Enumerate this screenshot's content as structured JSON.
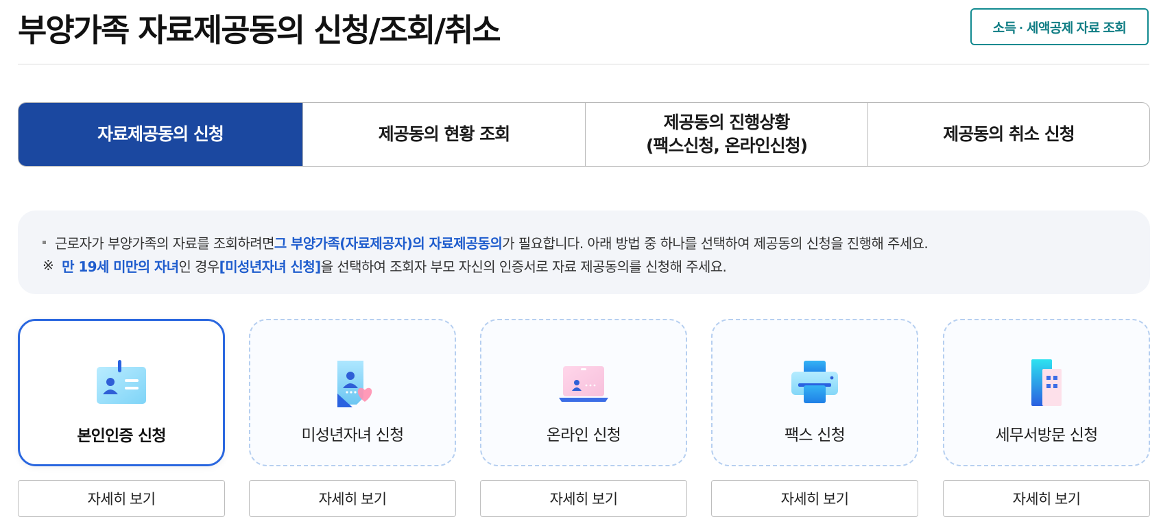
{
  "header": {
    "title": "부양가족 자료제공동의 신청/조회/취소",
    "top_button": "소득 · 세액공제 자료 조회"
  },
  "tabs": [
    {
      "lines": [
        "자료제공동의 신청"
      ],
      "active": true
    },
    {
      "lines": [
        "제공동의 현황 조회"
      ],
      "active": false
    },
    {
      "lines": [
        "제공동의 진행상황",
        "(팩스신청, 온라인신청)"
      ],
      "active": false
    },
    {
      "lines": [
        "제공동의 취소 신청"
      ],
      "active": false
    }
  ],
  "notice": {
    "line1": {
      "pre": "근로자가 부양가족의 자료를 조회하려면 ",
      "highlight": "그 부양가족(자료제공자)의 자료제공동의",
      "post": "가 필요합니다. 아래 방법 중 하나를 선택하여 제공동의 신청을 진행해 주세요."
    },
    "line2": {
      "mark": "※",
      "highlight1": "만 19세 미만의 자녀",
      "mid": "인 경우 ",
      "highlight2": "[미성년자녀 신청]",
      "post": "을 선택하여 조회자 부모 자신의 인증서로 자료 제공동의를 신청해 주세요."
    }
  },
  "cards": [
    {
      "label": "본인인증 신청",
      "icon": "id-card-icon",
      "selected": true,
      "detail": "자세히 보기"
    },
    {
      "label": "미성년자녀 신청",
      "icon": "child-document-heart-icon",
      "selected": false,
      "detail": "자세히 보기"
    },
    {
      "label": "온라인 신청",
      "icon": "laptop-icon",
      "selected": false,
      "detail": "자세히 보기"
    },
    {
      "label": "팩스 신청",
      "icon": "printer-fax-icon",
      "selected": false,
      "detail": "자세히 보기"
    },
    {
      "label": "세무서방문 신청",
      "icon": "tax-office-building-icon",
      "selected": false,
      "detail": "자세히 보기"
    }
  ],
  "colors": {
    "tab_active": "#1b48a0",
    "highlight": "#1e5ccd",
    "top_button": "#118a90",
    "card_selected_border": "#2a67df",
    "card_dashed_border": "#b6cff0"
  }
}
